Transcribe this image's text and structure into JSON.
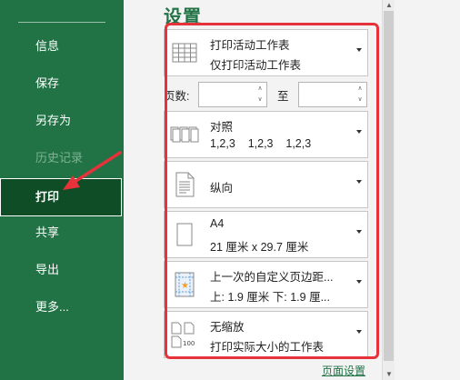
{
  "nav": {
    "items": [
      {
        "label": "信息"
      },
      {
        "label": "保存"
      },
      {
        "label": "另存为"
      },
      {
        "label": "历史记录"
      },
      {
        "label": "打印"
      },
      {
        "label": "共享"
      },
      {
        "label": "导出"
      },
      {
        "label": "更多..."
      }
    ]
  },
  "settings": {
    "title": "设置",
    "print_what": {
      "line1": "打印活动工作表",
      "line2": "仅打印活动工作表"
    },
    "pages": {
      "label": "页数:",
      "from_value": "",
      "to_label": "至",
      "to_value": ""
    },
    "collation": {
      "line1": "对照",
      "line2": "1,2,3    1,2,3    1,2,3"
    },
    "orientation": {
      "line1": "纵向"
    },
    "paper_size": {
      "line1": "A4",
      "line2": "21 厘米 x 29.7 厘米"
    },
    "margins": {
      "line1": "上一次的自定义页边距...",
      "line2": "上: 1.9 厘米 下: 1.9 厘..."
    },
    "scaling": {
      "line1": "无缩放",
      "line2": "打印实际大小的工作表"
    },
    "page_setup_link": "页面设置"
  },
  "colors": {
    "nav_bg": "#217346",
    "accent": "#217346",
    "highlight": "#e5323b"
  }
}
